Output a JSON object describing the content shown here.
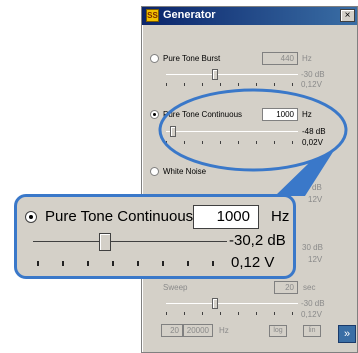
{
  "window": {
    "title": "Generator",
    "icon_text": "SS",
    "close_label": "×",
    "next_label": "»"
  },
  "sections": {
    "burst": {
      "label": "Pure Tone Burst",
      "value": "440",
      "unit": "Hz",
      "db": "-30 dB",
      "volts": "0,12V"
    },
    "continuous": {
      "label": "Pure Tone Continuous",
      "value": "1000",
      "unit": "Hz",
      "db": "-48 dB",
      "volts": "0,02V"
    },
    "white_noise": {
      "label": "White Noise",
      "db": "dB",
      "volts": "12V"
    },
    "hidden_row": {
      "db": "30 dB",
      "volts": "12V"
    },
    "sweep": {
      "label": "Sweep",
      "value": "20",
      "unit": "sec",
      "db": "-30 dB",
      "volts": "0,12V"
    }
  },
  "range": {
    "from": "20",
    "to": "20000",
    "unit": "Hz",
    "log_label": "log",
    "lin_label": "lin"
  },
  "zoom": {
    "label": "Pure Tone Continuous",
    "value": "1000",
    "unit": "Hz",
    "db": "-30,2 dB",
    "volts": "0,12 V"
  },
  "colors": {
    "accent": "#3a78c9",
    "titlebar": "#0a246a",
    "panel": "#d4d0c8"
  },
  "icons": [
    "app-icon",
    "close-icon",
    "next-arrow-icon"
  ]
}
